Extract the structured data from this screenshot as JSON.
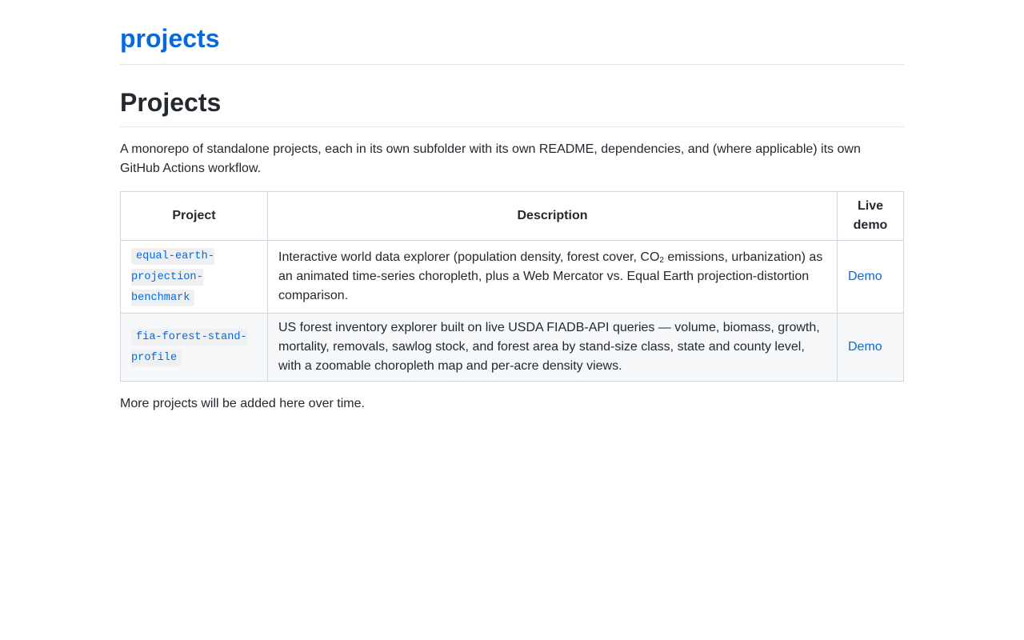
{
  "site": {
    "title": "projects"
  },
  "page": {
    "heading": "Projects",
    "intro": "A monorepo of standalone projects, each in its own subfolder with its own README, dependencies, and (where applicable) its own GitHub Actions workflow.",
    "footer": "More projects will be added here over time."
  },
  "table": {
    "headers": {
      "project": "Project",
      "description": "Description",
      "live_demo": "Live demo"
    },
    "rows": [
      {
        "project": "equal-earth-projection-benchmark",
        "description_before": "Interactive world data explorer (population density, forest cover, CO",
        "description_sub": "2",
        "description_after": " emissions, urbanization) as an animated time-series choropleth, plus a Web Mercator vs. Equal Earth projection-distortion comparison.",
        "demo_label": "Demo"
      },
      {
        "project": "fia-forest-stand-profile",
        "description": "US forest inventory explorer built on live USDA FIADB-API queries — volume, biomass, growth, mortality, removals, sawlog stock, and forest area by stand-size class, state and county level, with a zoomable choropleth map and per-acre density views.",
        "demo_label": "Demo"
      }
    ]
  }
}
